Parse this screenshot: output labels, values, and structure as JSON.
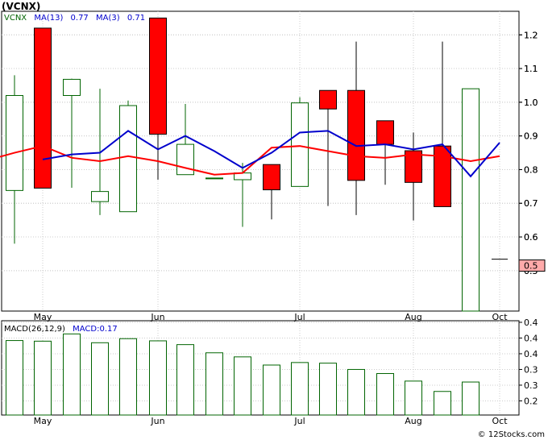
{
  "title": "(VCNX)",
  "watermark": "© 12Stocks.com",
  "colors": {
    "up": "#006400",
    "down": "#ff0000",
    "ma13": "#ff0000",
    "ma3": "#0000cc",
    "price_badge": "#ffaaaa",
    "macd_bar": "#006400"
  },
  "chart_data": [
    {
      "type": "candlestick",
      "panel": "price",
      "legend": {
        "ticker": "VCNX",
        "ma13_label": "MA(13)",
        "ma13_value": "0.77",
        "ma3_label": "MA(3)",
        "ma3_value": "0.71"
      },
      "y_ticks": [
        0.5,
        0.5,
        0.6,
        0.6,
        0.7,
        0.7,
        0.8,
        0.8,
        0.9,
        0.9,
        1.0,
        1.0,
        1.1,
        1.1,
        1.2,
        1.2
      ],
      "y_tick_labels": [
        "0.5",
        "0.5",
        "0.6",
        "0.6",
        "0.7",
        "0.7",
        "0.8",
        "0.8",
        "0.9",
        "0.9",
        "1.0",
        "1.0",
        "1.1",
        "1.1",
        "1.2",
        "1.2"
      ],
      "ylim": [
        0.38,
        1.27
      ],
      "x_month_labels": [
        "May",
        "Jun",
        "Jul",
        "Aug",
        "Oct"
      ],
      "candles": [
        {
          "open": 0.738,
          "high": 1.08,
          "low": 0.58,
          "close": 1.02
        },
        {
          "open": 1.22,
          "high": 1.22,
          "low": 0.745,
          "close": 0.745
        },
        {
          "open": 1.02,
          "high": 1.07,
          "low": 0.746,
          "close": 1.068
        },
        {
          "open": 0.705,
          "high": 1.04,
          "low": 0.665,
          "close": 0.735
        },
        {
          "open": 0.675,
          "high": 1.005,
          "low": 0.675,
          "close": 0.99
        },
        {
          "open": 1.25,
          "high": 1.25,
          "low": 0.77,
          "close": 0.905
        },
        {
          "open": 0.785,
          "high": 0.995,
          "low": 0.785,
          "close": 0.875
        },
        {
          "open": 0.775,
          "high": 0.775,
          "low": 0.775,
          "close": 0.775
        },
        {
          "open": 0.77,
          "high": 0.82,
          "low": 0.63,
          "close": 0.79
        },
        {
          "open": 0.815,
          "high": 0.815,
          "low": 0.652,
          "close": 0.74
        },
        {
          "open": 0.75,
          "high": 1.015,
          "low": 0.75,
          "close": 0.998
        },
        {
          "open": 1.035,
          "high": 1.035,
          "low": 0.692,
          "close": 0.98
        },
        {
          "open": 1.035,
          "high": 1.18,
          "low": 0.665,
          "close": 0.768
        },
        {
          "open": 0.945,
          "high": 0.945,
          "low": 0.755,
          "close": 0.875
        },
        {
          "open": 0.856,
          "high": 0.91,
          "low": 0.649,
          "close": 0.762
        },
        {
          "open": 0.87,
          "high": 1.18,
          "low": 0.69,
          "close": 0.69
        },
        {
          "open": 0.38,
          "high": 1.04,
          "low": 0.38,
          "close": 1.04
        }
      ],
      "ma13": [
        0.838,
        0.85,
        0.87,
        0.835,
        0.825,
        0.84,
        0.825,
        0.805,
        0.785,
        0.79,
        0.865,
        0.87,
        0.855,
        0.84,
        0.835,
        0.845,
        0.84,
        0.825,
        0.84
      ],
      "ma3": [
        null,
        null,
        0.83,
        0.845,
        0.85,
        0.915,
        0.86,
        0.9,
        0.855,
        0.805,
        0.85,
        0.91,
        0.915,
        0.87,
        0.875,
        0.86,
        0.875,
        0.78,
        0.88
      ],
      "last_price": {
        "value": 0.515,
        "label": "0.5"
      }
    },
    {
      "type": "bar",
      "panel": "macd",
      "legend": {
        "label": "MACD(26,12,9)",
        "value_label": "MACD:0.17"
      },
      "ylim": [
        0.155,
        0.455
      ],
      "y_ticks": [
        0.2,
        0.25,
        0.3,
        0.35,
        0.4,
        0.45
      ],
      "y_tick_labels": [
        "0.2",
        "0.3",
        "0.3",
        "0.4",
        "0.4",
        "0.4"
      ],
      "x_month_labels": [
        "May",
        "Jun",
        "Jul",
        "Aug",
        "Oct"
      ],
      "values": [
        0.392,
        0.39,
        0.413,
        0.385,
        0.398,
        0.391,
        0.379,
        0.353,
        0.34,
        0.314,
        0.322,
        0.32,
        0.3,
        0.287,
        0.263,
        0.23,
        0.26
      ]
    }
  ]
}
